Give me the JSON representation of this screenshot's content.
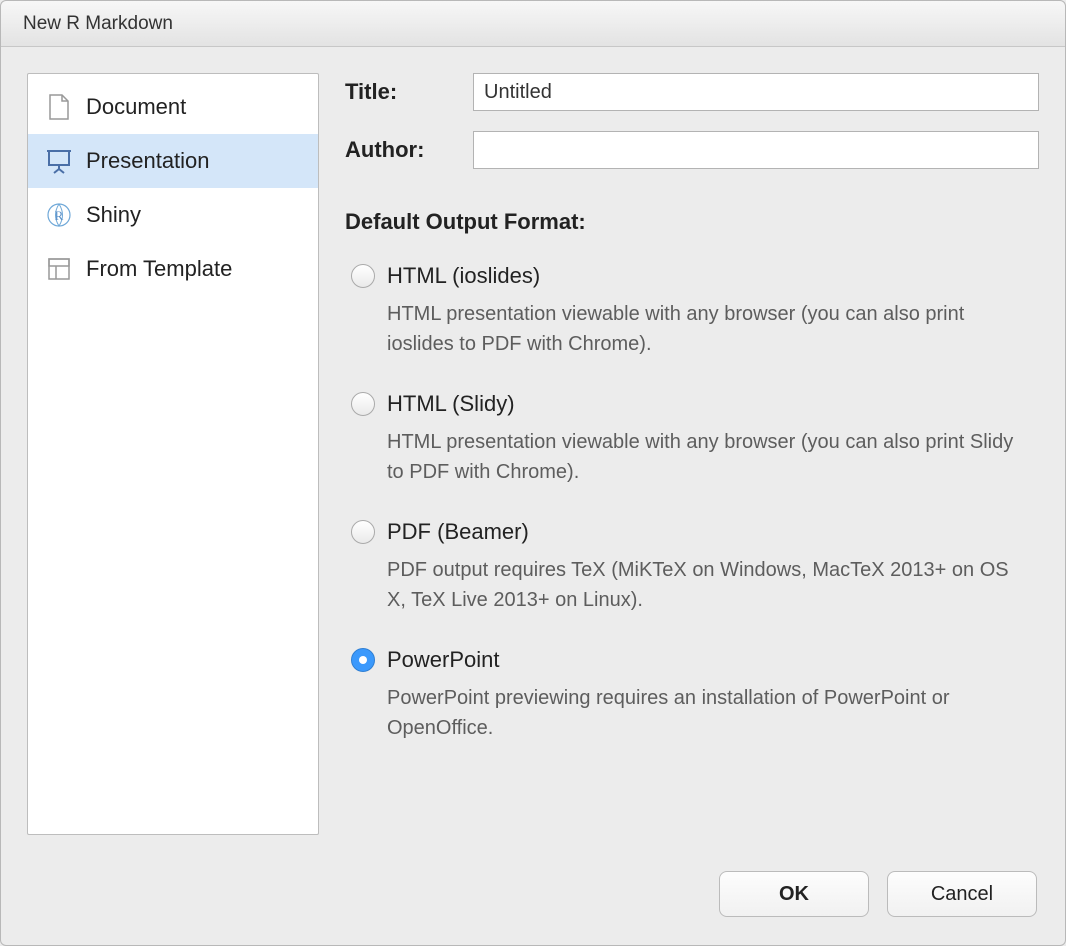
{
  "dialog": {
    "title": "New R Markdown"
  },
  "sidebar": {
    "items": [
      {
        "label": "Document",
        "selected": false
      },
      {
        "label": "Presentation",
        "selected": true
      },
      {
        "label": "Shiny",
        "selected": false
      },
      {
        "label": "From Template",
        "selected": false
      }
    ]
  },
  "form": {
    "title_label": "Title:",
    "title_value": "Untitled",
    "author_label": "Author:",
    "author_value": ""
  },
  "section": {
    "header": "Default Output Format:"
  },
  "formats": [
    {
      "title": "HTML (ioslides)",
      "desc": "HTML presentation viewable with any browser (you can also print ioslides to PDF with Chrome).",
      "checked": false
    },
    {
      "title": "HTML (Slidy)",
      "desc": "HTML presentation viewable with any browser (you can also print Slidy to PDF with Chrome).",
      "checked": false
    },
    {
      "title": "PDF (Beamer)",
      "desc": "PDF output requires TeX (MiKTeX on Windows, MacTeX 2013+ on OS X, TeX Live 2013+ on Linux).",
      "checked": false
    },
    {
      "title": "PowerPoint",
      "desc": "PowerPoint previewing requires an installation of PowerPoint or OpenOffice.",
      "checked": true
    }
  ],
  "buttons": {
    "ok": "OK",
    "cancel": "Cancel"
  }
}
